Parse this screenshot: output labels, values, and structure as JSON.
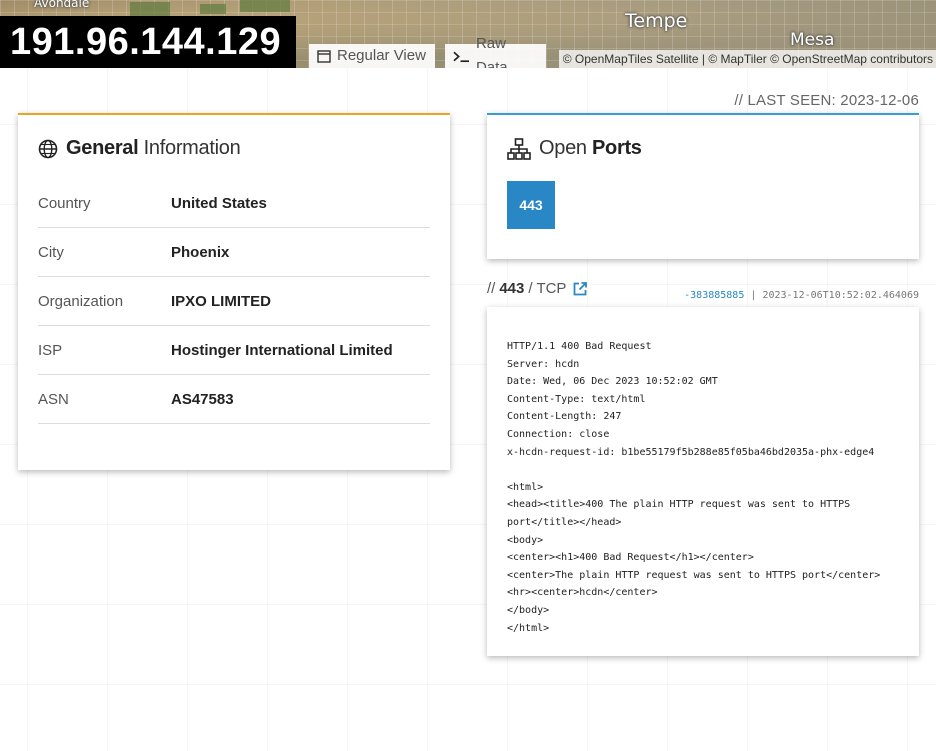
{
  "header": {
    "ip": "191.96.144.129",
    "map_labels": {
      "avondale": "Avondale",
      "tempe": "Tempe",
      "mesa": "Mesa"
    },
    "view_buttons": [
      {
        "label": "Regular View",
        "icon": "window-icon"
      },
      {
        "label": "Raw Data",
        "icon": "terminal-icon"
      }
    ],
    "attribution": "© OpenMapTiles Satellite | © MapTiler © OpenStreetMap contributors"
  },
  "last_seen": "// LAST SEEN: 2023-12-06",
  "general": {
    "title_bold": "General",
    "title_light": "Information",
    "icon": "globe-icon",
    "accent": "#e5a623",
    "rows": [
      {
        "key": "Country",
        "value": "United States"
      },
      {
        "key": "City",
        "value": "Phoenix"
      },
      {
        "key": "Organization",
        "value": "IPXO LIMITED"
      },
      {
        "key": "ISP",
        "value": "Hostinger International Limited"
      },
      {
        "key": "ASN",
        "value": "AS47583"
      }
    ]
  },
  "ports": {
    "title_light": "Open",
    "title_bold": "Ports",
    "icon": "network-icon",
    "accent": "#3a9bd5",
    "list": [
      "443"
    ]
  },
  "service": {
    "prefix": "//",
    "port": "443",
    "protocol": "/ TCP",
    "hash": "-383885885",
    "separator": "|",
    "timestamp": "2023-12-06T10:52:02.464069",
    "banner": "HTTP/1.1 400 Bad Request\nServer: hcdn\nDate: Wed, 06 Dec 2023 10:52:02 GMT\nContent-Type: text/html\nContent-Length: 247\nConnection: close\nx-hcdn-request-id: b1be55179f5b288e85f05ba46bd2035a-phx-edge4\n\n<html>\n<head><title>400 The plain HTTP request was sent to HTTPS port</title></head>\n<body>\n<center><h1>400 Bad Request</h1></center>\n<center>The plain HTTP request was sent to HTTPS port</center>\n<hr><center>hcdn</center>\n</body>\n</html>"
  }
}
